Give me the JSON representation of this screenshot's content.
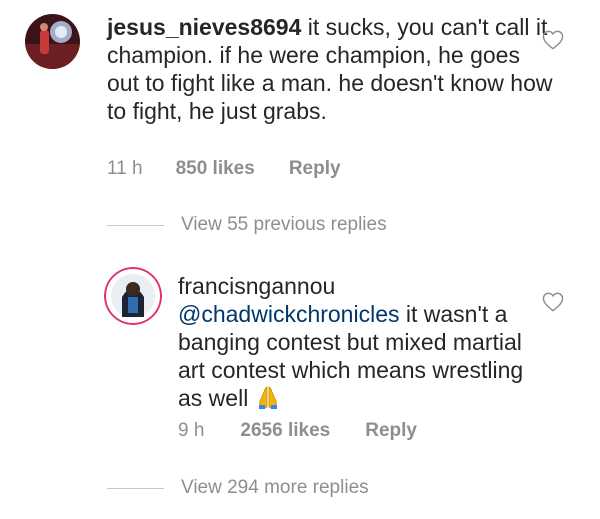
{
  "comments": [
    {
      "username": "jesus_nieves8694",
      "text": " it sucks, you can't call it champion. if he were champion, he goes out to fight like a man. he doesn't know how to fight, he just grabs.",
      "time": "11 h",
      "likes": "850 likes",
      "reply": "Reply"
    }
  ],
  "view_previous": "View 55 previous replies",
  "reply_comment": {
    "username": "francisngannou",
    "mention": "@chadwickchronicles",
    "text": " it wasn't a banging contest but mixed martial art contest which means wrestling as well ",
    "emoji": "folded-hands",
    "time": "9 h",
    "likes": "2656 likes",
    "reply": "Reply"
  },
  "view_more": "View 294 more replies",
  "icons": {
    "like": "heart-outline-icon"
  },
  "colors": {
    "text": "#262626",
    "secondary": "#8e8e8e",
    "mention": "#00376b",
    "story_ring": "#e1306c"
  }
}
